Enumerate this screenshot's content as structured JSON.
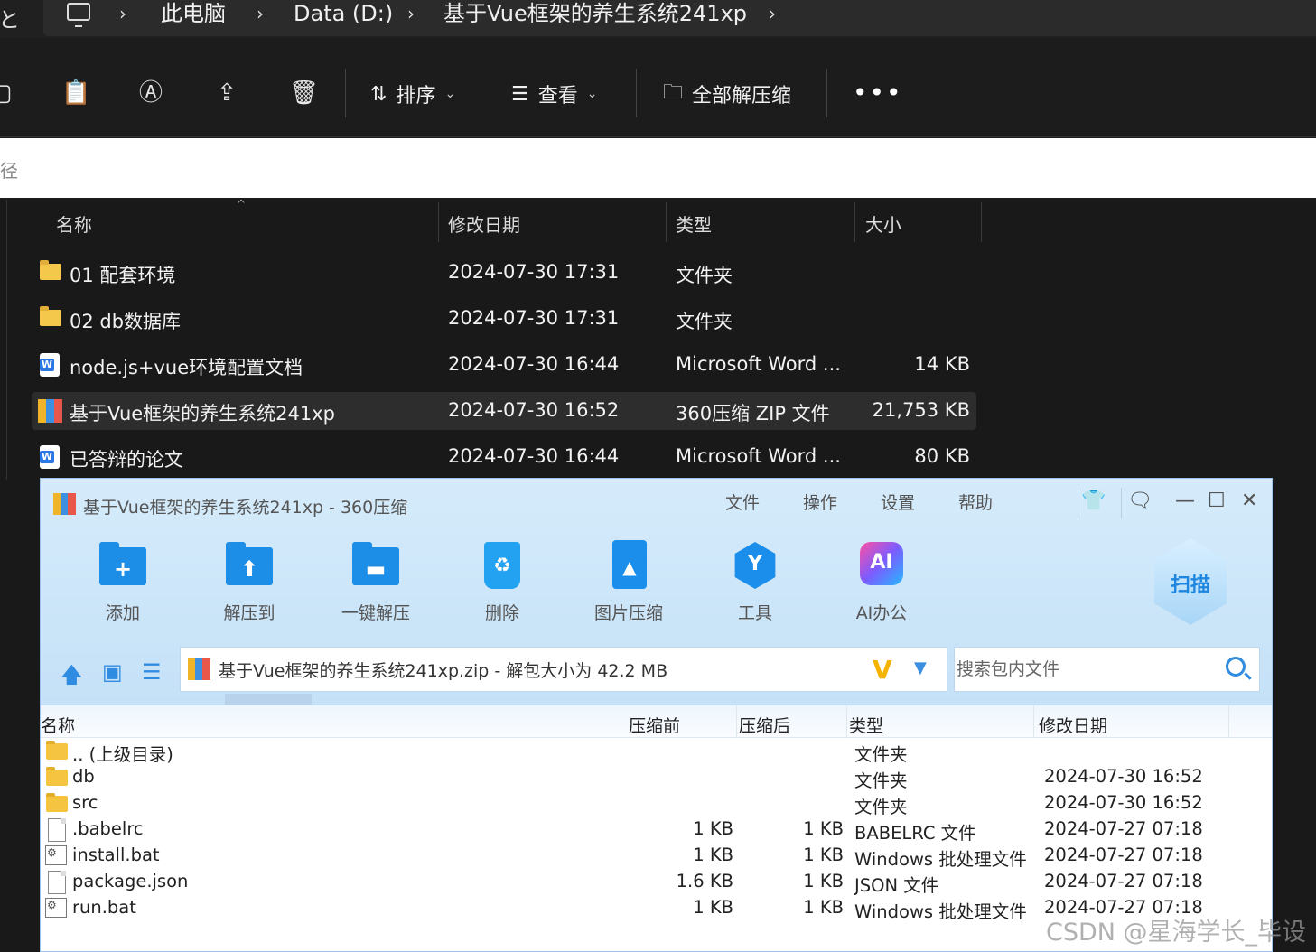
{
  "explorer": {
    "breadcrumb": [
      {
        "label": "此电脑"
      },
      {
        "label": "Data (D:)"
      },
      {
        "label": "基于Vue框架的养生系统241xp"
      }
    ],
    "left_edge_glyph": "と",
    "toolbar": {
      "sort_label": "排序",
      "view_label": "查看",
      "extract_all_label": "全部解压缩",
      "more_label": "•••"
    },
    "search_path_fragment": "径",
    "columns": {
      "name": "名称",
      "date": "修改日期",
      "type": "类型",
      "size": "大小"
    },
    "files": [
      {
        "name": "01 配套环境",
        "date": "2024-07-30 17:31",
        "type": "文件夹",
        "size": "",
        "icon": "folder-icon"
      },
      {
        "name": "02 db数据库",
        "date": "2024-07-30 17:31",
        "type": "文件夹",
        "size": "",
        "icon": "folder-icon"
      },
      {
        "name": "node.js+vue环境配置文档",
        "date": "2024-07-30 16:44",
        "type": "Microsoft Word ...",
        "size": "14 KB",
        "icon": "word-doc-icon"
      },
      {
        "name": "基于Vue框架的养生系统241xp",
        "date": "2024-07-30 16:52",
        "type": "360压缩 ZIP 文件",
        "size": "21,753 KB",
        "icon": "zip-archive-icon",
        "selected": true
      },
      {
        "name": "已答辩的论文",
        "date": "2024-07-30 16:44",
        "type": "Microsoft Word ...",
        "size": "80 KB",
        "icon": "word-doc-icon"
      }
    ]
  },
  "zip_window": {
    "title": "基于Vue框架的养生系统241xp - 360压缩",
    "menu": [
      "文件",
      "操作",
      "设置",
      "帮助"
    ],
    "window_controls": {
      "minimize": "—",
      "maximize": "☐",
      "close": "✕"
    },
    "tools": [
      {
        "label": "添加",
        "icon": "add-folder-icon",
        "glyph": "+"
      },
      {
        "label": "解压到",
        "icon": "extract-to-icon",
        "glyph": "⬆"
      },
      {
        "label": "一键解压",
        "icon": "one-click-extract-icon",
        "glyph": "▬"
      },
      {
        "label": "删除",
        "icon": "delete-bin-icon",
        "glyph": "♻"
      },
      {
        "label": "图片压缩",
        "icon": "image-compress-icon",
        "glyph": "▲"
      },
      {
        "label": "工具",
        "icon": "tools-icon",
        "glyph": "Y"
      },
      {
        "label": "AI办公",
        "icon": "ai-office-icon",
        "glyph": "AI"
      }
    ],
    "scan_label": "扫描",
    "path_text": "基于Vue框架的养生系统241xp.zip - 解包大小为 42.2 MB",
    "v_logo": "V",
    "search_placeholder": "搜索包内文件",
    "columns": {
      "name": "名称",
      "before": "压缩前",
      "after": "压缩后",
      "type": "类型",
      "date": "修改日期"
    },
    "files": [
      {
        "name": ".. (上级目录)",
        "before": "",
        "after": "",
        "type": "文件夹",
        "date": "",
        "icon": "folder-icon"
      },
      {
        "name": "db",
        "before": "",
        "after": "",
        "type": "文件夹",
        "date": "2024-07-30 16:52",
        "icon": "folder-icon"
      },
      {
        "name": "src",
        "before": "",
        "after": "",
        "type": "文件夹",
        "date": "2024-07-30 16:52",
        "icon": "folder-icon"
      },
      {
        "name": ".babelrc",
        "before": "1 KB",
        "after": "1 KB",
        "type": "BABELRC 文件",
        "date": "2024-07-27 07:18",
        "icon": "file-icon"
      },
      {
        "name": "install.bat",
        "before": "1 KB",
        "after": "1 KB",
        "type": "Windows 批处理文件",
        "date": "2024-07-27 07:18",
        "icon": "batch-file-icon"
      },
      {
        "name": "package.json",
        "before": "1.6 KB",
        "after": "1 KB",
        "type": "JSON 文件",
        "date": "2024-07-27 07:18",
        "icon": "file-icon"
      },
      {
        "name": "run.bat",
        "before": "1 KB",
        "after": "1 KB",
        "type": "Windows 批处理文件",
        "date": "2024-07-27 07:18",
        "icon": "batch-file-icon"
      }
    ]
  },
  "watermark": "CSDN @星海学长_毕设",
  "colors": {
    "explorer_bg": "#191919",
    "selected_row": "#2d2d2d",
    "zip_accent": "#1c8ee8",
    "zip_header_bg": "#d5ebfb"
  }
}
